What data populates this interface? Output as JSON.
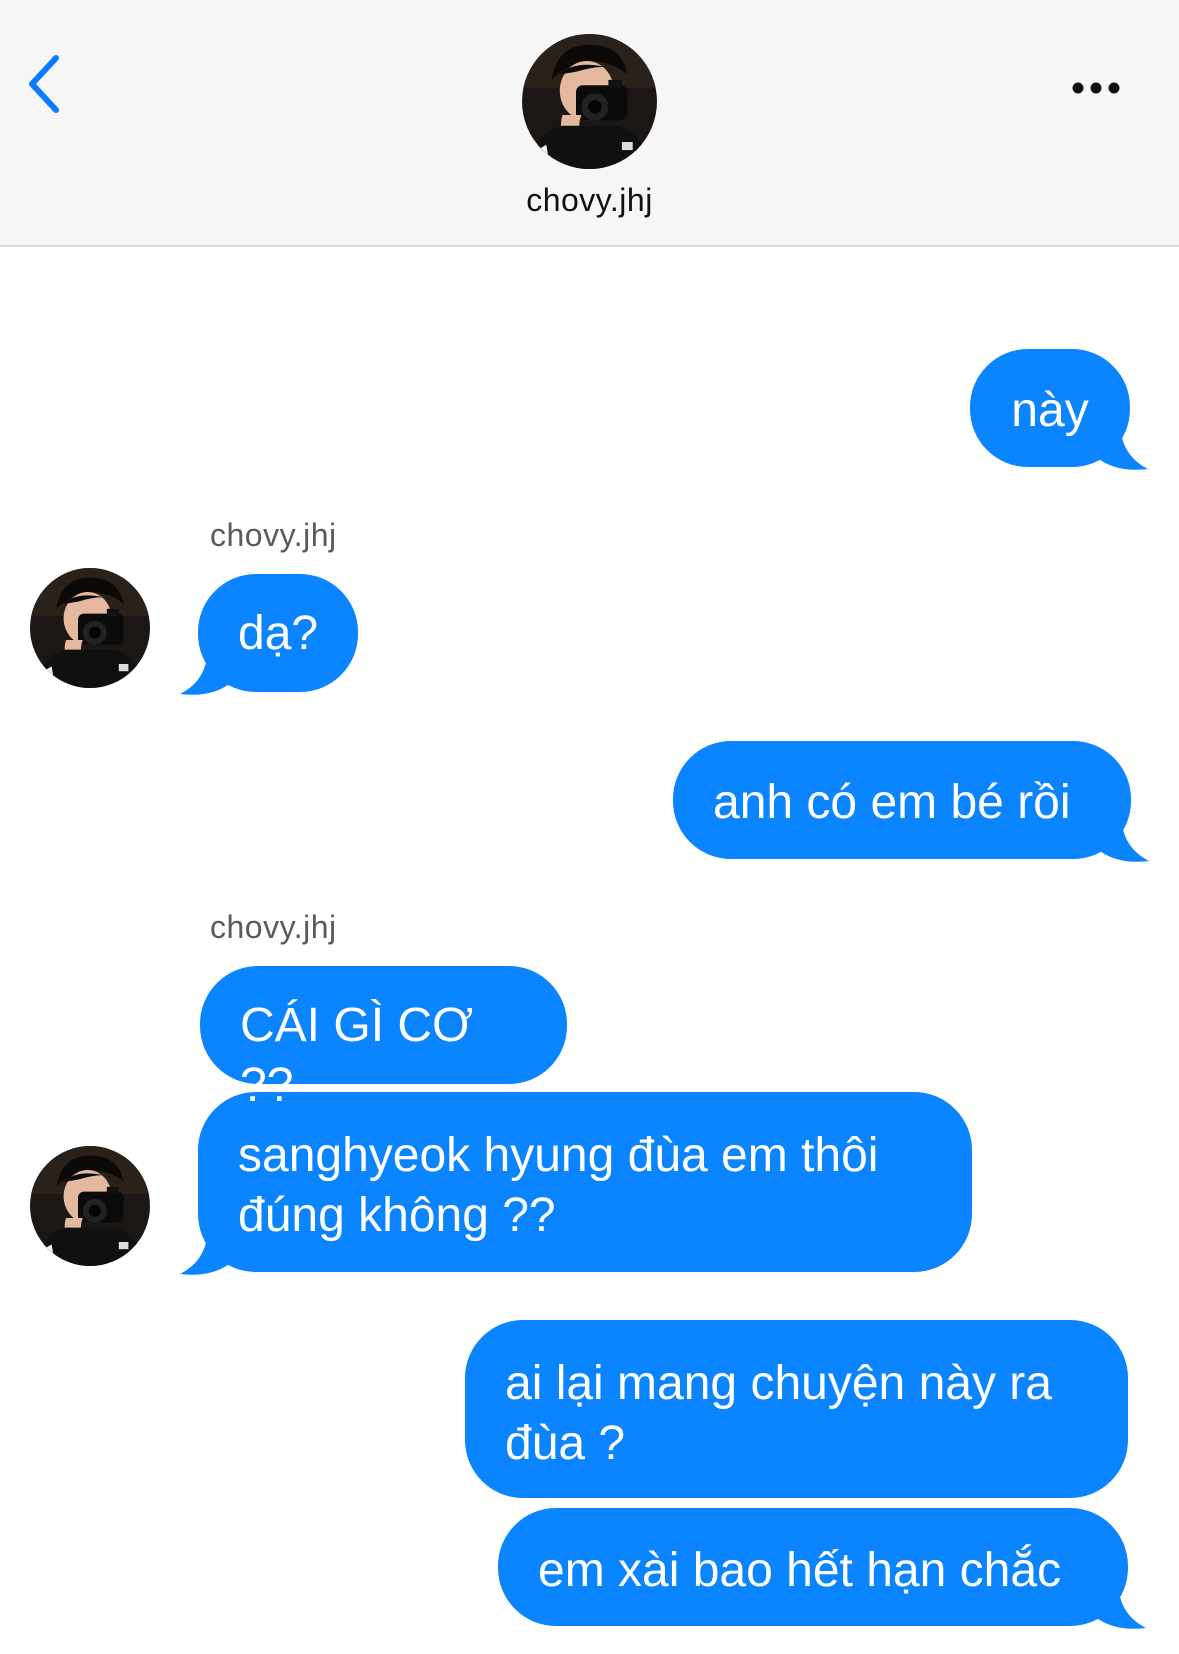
{
  "header": {
    "contact_name": "chovy.jhj",
    "back_icon": "chevron-left-icon",
    "more_icon": "ellipsis-icon"
  },
  "colors": {
    "bubble": "#0a84ff",
    "header_bg": "#f6f6f6",
    "accent": "#0a7aff"
  },
  "conversation": {
    "messages": [
      {
        "from": "me",
        "text": "này"
      },
      {
        "from": "chovy.jhj",
        "sender_label": "chovy.jhj",
        "text": "dạ?"
      },
      {
        "from": "me",
        "text": "anh có em bé rồi"
      },
      {
        "from": "chovy.jhj",
        "sender_label": "chovy.jhj",
        "text": "CÁI GÌ CƠ ??"
      },
      {
        "from": "chovy.jhj",
        "text_line1": "sanghyeok hyung đùa em thôi",
        "text_line2": "đúng không ??"
      },
      {
        "from": "me",
        "text_line1": "ai lại mang chuyện này ra",
        "text_line2": "đùa ?"
      },
      {
        "from": "me",
        "text": "em xài bao hết hạn chắc"
      }
    ]
  }
}
